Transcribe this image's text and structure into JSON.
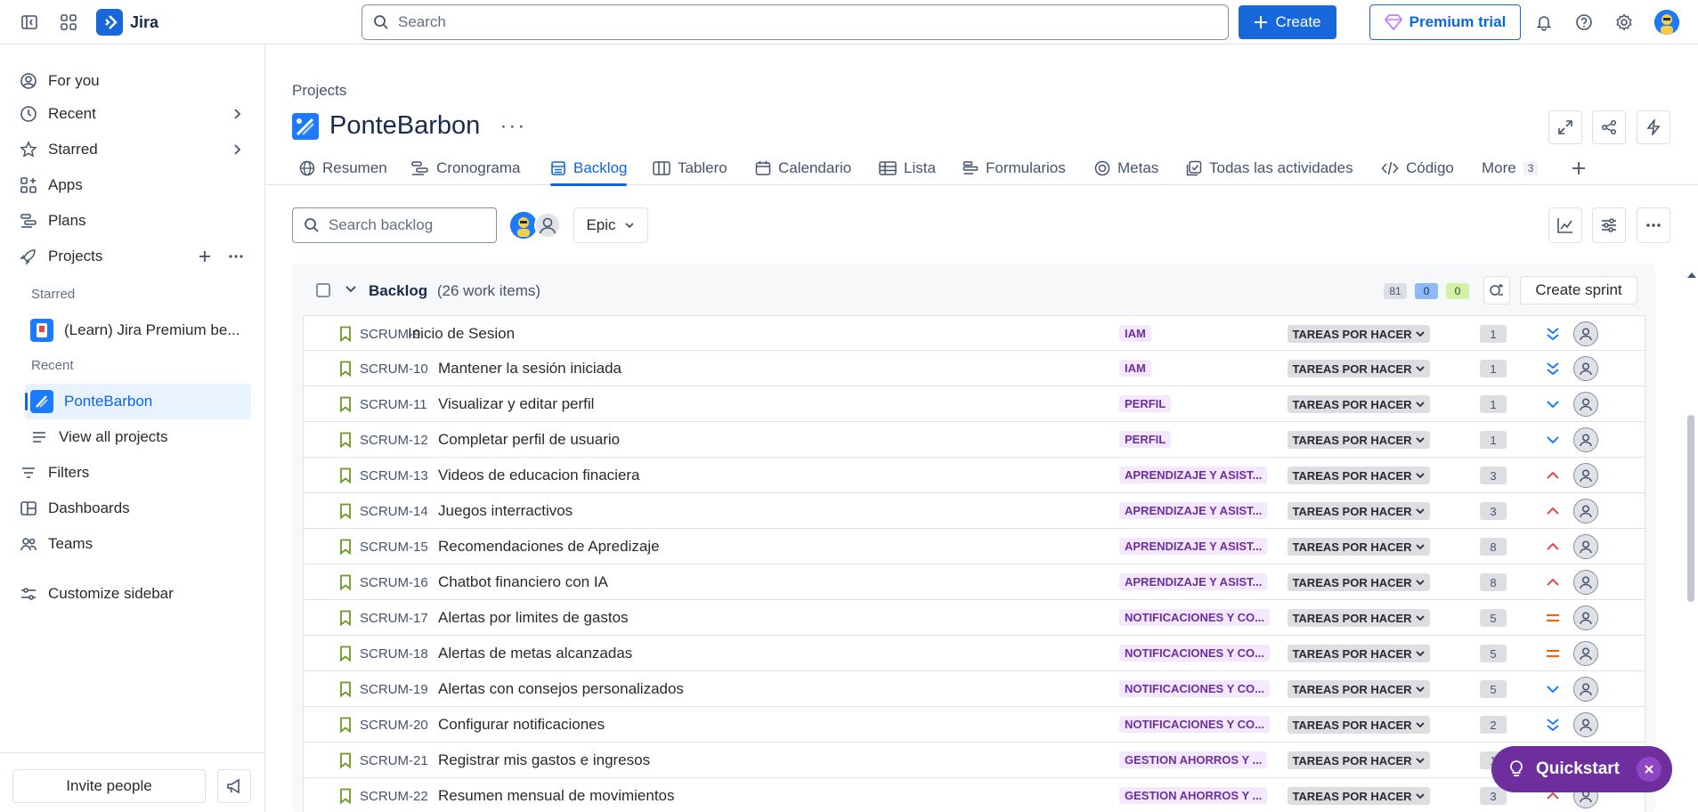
{
  "app": {
    "name": "Jira"
  },
  "topbar": {
    "search_placeholder": "Search",
    "create_label": "Create",
    "premium_label": "Premium trial"
  },
  "sidebar": {
    "items": {
      "for_you": "For you",
      "recent": "Recent",
      "starred": "Starred",
      "apps": "Apps",
      "plans": "Plans",
      "projects": "Projects",
      "filters": "Filters",
      "dashboards": "Dashboards",
      "teams": "Teams",
      "customize": "Customize sidebar"
    },
    "section_starred": "Starred",
    "section_recent": "Recent",
    "starred_project": "(Learn) Jira Premium be...",
    "recent_project": "PonteBarbon",
    "view_all": "View all projects",
    "invite": "Invite people"
  },
  "header": {
    "breadcrumb": "Projects",
    "project_name": "PonteBarbon",
    "more": "···"
  },
  "tabs": {
    "resumen": "Resumen",
    "cronograma": "Cronograma",
    "backlog": "Backlog",
    "tablero": "Tablero",
    "calendario": "Calendario",
    "lista": "Lista",
    "formularios": "Formularios",
    "metas": "Metas",
    "actividades": "Todas las actividades",
    "codigo": "Código",
    "more": "More",
    "more_count": "3"
  },
  "toolbar": {
    "search_placeholder": "Search backlog",
    "epic_label": "Epic"
  },
  "backlog": {
    "title": "Backlog",
    "count": "(26 work items)",
    "todo_points": "81",
    "inprogress_points": "0",
    "done_points": "0",
    "create_sprint": "Create sprint",
    "rows": [
      {
        "key": "SCRUM-9",
        "summary": "Inicio de Sesion",
        "epic": "IAM",
        "status": "TAREAS POR HACER",
        "estimate": "1",
        "priority": "lowest"
      },
      {
        "key": "SCRUM-10",
        "summary": "Mantener la sesión iniciada",
        "epic": "IAM",
        "status": "TAREAS POR HACER",
        "estimate": "1",
        "priority": "lowest"
      },
      {
        "key": "SCRUM-11",
        "summary": "Visualizar y editar perfil",
        "epic": "PERFIL",
        "status": "TAREAS POR HACER",
        "estimate": "1",
        "priority": "low"
      },
      {
        "key": "SCRUM-12",
        "summary": "Completar perfil de usuario",
        "epic": "PERFIL",
        "status": "TAREAS POR HACER",
        "estimate": "1",
        "priority": "low"
      },
      {
        "key": "SCRUM-13",
        "summary": "Videos de educacion finaciera",
        "epic": "APRENDIZAJE Y ASIST...",
        "status": "TAREAS POR HACER",
        "estimate": "3",
        "priority": "high"
      },
      {
        "key": "SCRUM-14",
        "summary": "Juegos interractivos",
        "epic": "APRENDIZAJE Y ASIST...",
        "status": "TAREAS POR HACER",
        "estimate": "3",
        "priority": "high"
      },
      {
        "key": "SCRUM-15",
        "summary": "Recomendaciones de Apredizaje",
        "epic": "APRENDIZAJE Y ASIST...",
        "status": "TAREAS POR HACER",
        "estimate": "8",
        "priority": "high"
      },
      {
        "key": "SCRUM-16",
        "summary": "Chatbot financiero con IA",
        "epic": "APRENDIZAJE Y ASIST...",
        "status": "TAREAS POR HACER",
        "estimate": "8",
        "priority": "high"
      },
      {
        "key": "SCRUM-17",
        "summary": "Alertas por limites de gastos",
        "epic": "NOTIFICACIONES Y CO...",
        "status": "TAREAS POR HACER",
        "estimate": "5",
        "priority": "medium"
      },
      {
        "key": "SCRUM-18",
        "summary": "Alertas de metas alcanzadas",
        "epic": "NOTIFICACIONES Y CO...",
        "status": "TAREAS POR HACER",
        "estimate": "5",
        "priority": "medium"
      },
      {
        "key": "SCRUM-19",
        "summary": "Alertas con consejos personalizados",
        "epic": "NOTIFICACIONES Y CO...",
        "status": "TAREAS POR HACER",
        "estimate": "5",
        "priority": "low"
      },
      {
        "key": "SCRUM-20",
        "summary": "Configurar notificaciones",
        "epic": "NOTIFICACIONES Y CO...",
        "status": "TAREAS POR HACER",
        "estimate": "2",
        "priority": "lowest"
      },
      {
        "key": "SCRUM-21",
        "summary": "Registrar mis gastos e ingresos",
        "epic": "GESTION AHORROS Y ...",
        "status": "TAREAS POR HACER",
        "estimate": "1",
        "priority": "high"
      },
      {
        "key": "SCRUM-22",
        "summary": "Resumen mensual de movimientos",
        "epic": "GESTION AHORROS Y ...",
        "status": "TAREAS POR HACER",
        "estimate": "3",
        "priority": "high"
      }
    ]
  },
  "quickstart": {
    "label": "Quickstart"
  },
  "colors": {
    "accent": "#1868db",
    "epic_bg": "#f3e8fd",
    "epic_text": "#6e2e9e",
    "quickstart": "#6e2e9e",
    "priority_high": "#e2483d",
    "priority_medium": "#e56910",
    "priority_low": "#1d7afc"
  }
}
